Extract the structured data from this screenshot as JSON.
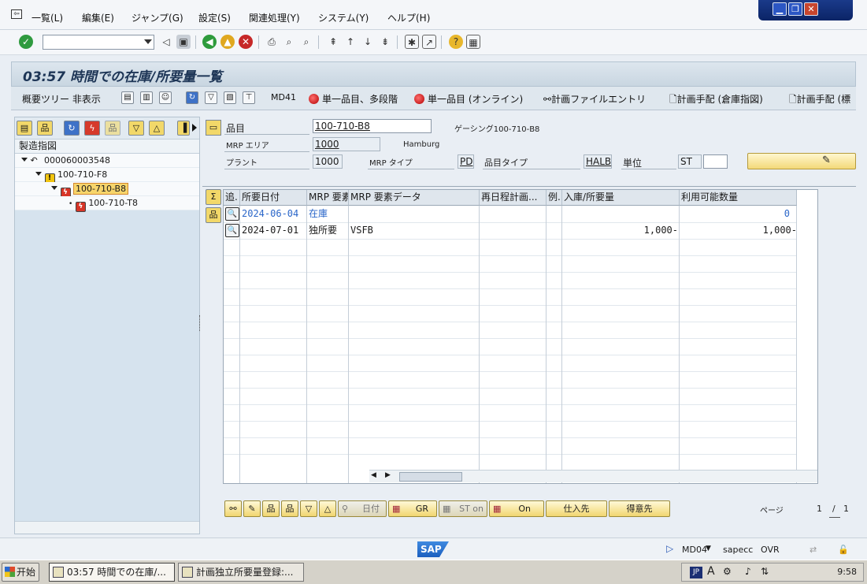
{
  "menu": {
    "items": [
      "一覧(L)",
      "編集(E)",
      "ジャンプ(G)",
      "設定(S)",
      "関連処理(Y)",
      "システム(Y)",
      "ヘルプ(H)"
    ]
  },
  "window_buttons": {
    "minimize": "▁",
    "restore": "❐",
    "close": "✕"
  },
  "command_field": {
    "value": ""
  },
  "title": "03:57 時間での在庫/所要量一覧",
  "app_toolbar": {
    "hide_tree": "概要ツリー 非表示",
    "md41": "MD41",
    "single_multi": "単一品目、多段階",
    "single_online": "単一品目 (オンライン)",
    "planning_file": "計画ファイルエントリ",
    "procurement_storage": "計画手配 (倉庫指図)",
    "procurement_more": "計画手配 (標"
  },
  "tree": {
    "header": "製造指図",
    "nodes": [
      {
        "label": "000060003548",
        "level": 0
      },
      {
        "label": "100-710-F8",
        "level": 1
      },
      {
        "label": "100-710-B8",
        "level": 2,
        "selected": true
      },
      {
        "label": "100-710-T8",
        "level": 3
      }
    ]
  },
  "header": {
    "material_label": "品目",
    "material_value": "100-710-B8",
    "material_desc": "ゲーシング100-710-B8",
    "mrp_area_label": "MRP エリア",
    "mrp_area_value": "1000",
    "mrp_area_name": "Hamburg",
    "plant_label": "プラント",
    "plant_value": "1000",
    "mrp_type_label": "MRP タイプ",
    "mrp_type_value": "PD",
    "material_type_label": "品目タイプ",
    "material_type_value": "HALB",
    "unit_label": "単位",
    "unit_value": "ST"
  },
  "grid": {
    "columns": [
      "追.",
      "所要日付",
      "MRP 要素",
      "MRP 要素データ",
      "再日程計画...",
      "例.",
      "入庫/所要量",
      "利用可能数量"
    ],
    "rows": [
      {
        "date": "2024-06-04",
        "element": "在庫",
        "data": "",
        "reschedule": "",
        "exception": "",
        "qty": "",
        "available": "0"
      },
      {
        "date": "2024-07-01",
        "element": "独所要",
        "data": "VSFB",
        "reschedule": "",
        "exception": "",
        "qty": "1,000-",
        "available": "1,000-"
      }
    ]
  },
  "function_bar": {
    "date_label": "日付",
    "gr_label": "GR",
    "st_on_label": "ST on",
    "on_label": "On",
    "vendor_label": "仕入先",
    "customer_label": "得意先",
    "page_label": "ページ",
    "page_current": "1",
    "page_sep": "/",
    "page_total": "1"
  },
  "status": {
    "sap": "SAP",
    "transaction": "MD04",
    "user": "sapecc",
    "mode": "OVR"
  },
  "taskbar": {
    "start": "开始",
    "tasks": [
      "03:57 時間での在庫/...",
      "計画独立所要量登録:..."
    ],
    "ime": "JP",
    "time": "9:58"
  }
}
